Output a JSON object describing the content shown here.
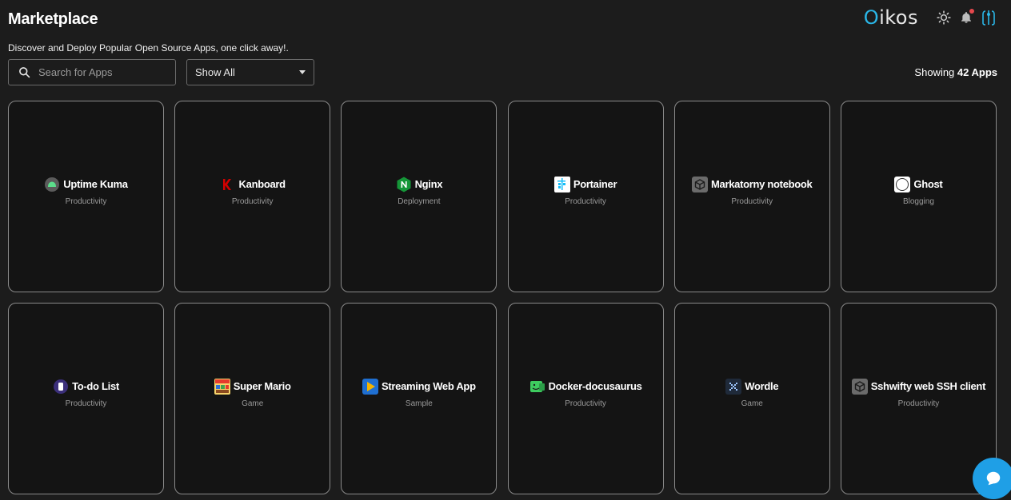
{
  "header": {
    "title": "Marketplace",
    "subtitle": "Discover and Deploy Popular Open Source Apps, one click away!.",
    "brand_first": "O",
    "brand_rest": "ikos"
  },
  "toolbar": {
    "search_placeholder": "Search for Apps",
    "filter_value": "Show All",
    "count_prefix": "Showing ",
    "count_value": "42 Apps"
  },
  "apps": [
    {
      "name": "Uptime Kuma",
      "category": "Productivity",
      "icon": "uptime-kuma-icon"
    },
    {
      "name": "Kanboard",
      "category": "Productivity",
      "icon": "kanboard-icon"
    },
    {
      "name": "Nginx",
      "category": "Deployment",
      "icon": "nginx-icon"
    },
    {
      "name": "Portainer",
      "category": "Productivity",
      "icon": "portainer-icon"
    },
    {
      "name": "Markatorny notebook",
      "category": "Productivity",
      "icon": "cube-icon"
    },
    {
      "name": "Ghost",
      "category": "Blogging",
      "icon": "ghost-icon"
    },
    {
      "name": "To-do List",
      "category": "Productivity",
      "icon": "todo-icon"
    },
    {
      "name": "Super Mario",
      "category": "Game",
      "icon": "super-mario-icon"
    },
    {
      "name": "Streaming Web App",
      "category": "Sample",
      "icon": "play-icon"
    },
    {
      "name": "Docker-docusaurus",
      "category": "Productivity",
      "icon": "docusaurus-icon"
    },
    {
      "name": "Wordle",
      "category": "Game",
      "icon": "wordle-icon"
    },
    {
      "name": "Sshwifty web SSH client",
      "category": "Productivity",
      "icon": "cube-icon"
    }
  ],
  "colors": {
    "background": "#1c1c1c",
    "card": "#141414",
    "accent": "#1f9fe6",
    "notification": "#e5484d"
  }
}
